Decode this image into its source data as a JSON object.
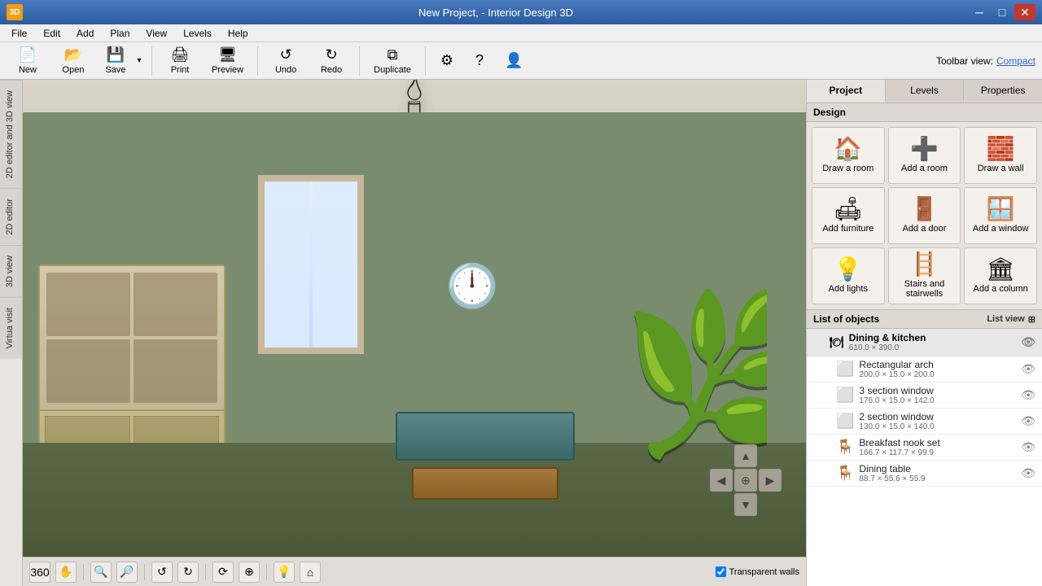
{
  "window": {
    "title": "New Project,  - Interior Design 3D",
    "app_icon": "3D"
  },
  "titlebar_controls": {
    "minimize": "─",
    "restore": "□",
    "close": "✕"
  },
  "menubar": {
    "items": [
      "File",
      "Edit",
      "Add",
      "Plan",
      "View",
      "Levels",
      "Help"
    ]
  },
  "toolbar": {
    "new_label": "New",
    "open_label": "Open",
    "save_label": "Save",
    "print_label": "Print",
    "preview_label": "Preview",
    "undo_label": "Undo",
    "redo_label": "Redo",
    "duplicate_label": "Duplicate",
    "settings_label": "⚙",
    "help_label": "?",
    "toolbar_view_text": "Toolbar view:",
    "compact_label": "Compact"
  },
  "left_tabs": {
    "items": [
      "2D editor and 3D view",
      "2D editor",
      "3D view",
      "Virtua visit"
    ]
  },
  "right_panel": {
    "tabs": [
      "Project",
      "Levels",
      "Properties"
    ],
    "active_tab": 0,
    "design_header": "Design",
    "design_items": [
      {
        "id": "draw-room",
        "icon": "🏠",
        "label": "Draw a room"
      },
      {
        "id": "add-room",
        "icon": "➕",
        "label": "Add a room"
      },
      {
        "id": "draw-wall",
        "icon": "🧱",
        "label": "Draw a wall"
      },
      {
        "id": "add-furniture",
        "icon": "🛋",
        "label": "Add furniture"
      },
      {
        "id": "add-door",
        "icon": "🚪",
        "label": "Add a door"
      },
      {
        "id": "add-window",
        "icon": "🪟",
        "label": "Add a window"
      },
      {
        "id": "add-lights",
        "icon": "💡",
        "label": "Add lights"
      },
      {
        "id": "stairs",
        "icon": "🪜",
        "label": "Stairs and stairwells"
      },
      {
        "id": "add-column",
        "icon": "🏛",
        "label": "Add a column"
      }
    ],
    "objects_header": "List of objects",
    "list_view_label": "List view",
    "objects": [
      {
        "group": "Dining & kitchen",
        "dims": "610.0 × 390.0",
        "icon": "🍽",
        "items": [
          {
            "name": "Rectangular arch",
            "dims": "200.0 × 15.0 × 200.0",
            "icon": "⬜"
          },
          {
            "name": "3 section window",
            "dims": "176.0 × 15.0 × 142.0",
            "icon": "⬜"
          },
          {
            "name": "2 section window",
            "dims": "130.0 × 15.0 × 140.0",
            "icon": "⬜"
          },
          {
            "name": "Breakfast nook set",
            "dims": "166.7 × 117.7 × 99.9",
            "icon": "🪑"
          },
          {
            "name": "Dining table",
            "dims": "88.7 × 55.6 × 55.9",
            "icon": "🪑"
          }
        ]
      }
    ]
  },
  "canvas": {
    "transparent_walls_label": "Transparent walls",
    "transparent_walls_checked": true
  },
  "canvas_tools": [
    {
      "id": "360",
      "label": "360"
    },
    {
      "id": "hand",
      "label": "✋"
    },
    {
      "id": "zoom-out",
      "label": "🔍-"
    },
    {
      "id": "zoom-in",
      "label": "🔍+"
    },
    {
      "id": "undo-view",
      "label": "↺"
    },
    {
      "id": "redo-view",
      "label": "↻"
    },
    {
      "id": "orbit",
      "label": "⟳"
    },
    {
      "id": "pan",
      "label": "⊕"
    },
    {
      "id": "light",
      "label": "💡"
    },
    {
      "id": "home",
      "label": "⌂"
    }
  ]
}
